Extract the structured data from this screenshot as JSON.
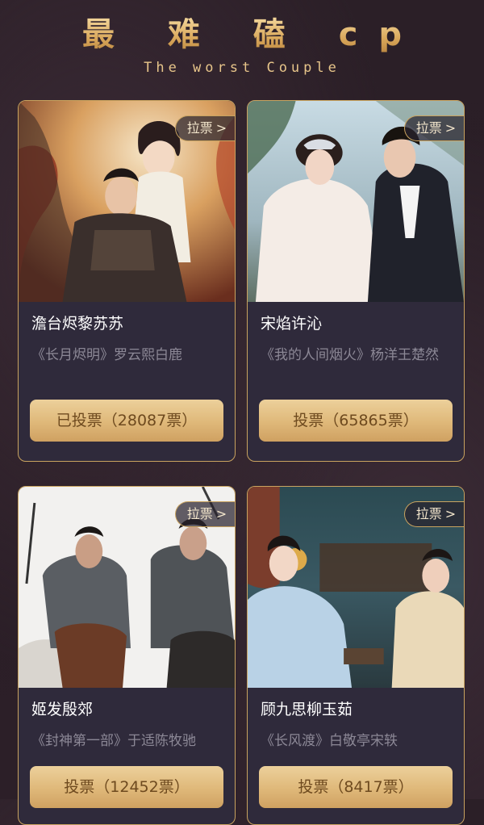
{
  "header": {
    "title": "最 难 磕 cp",
    "subtitle": "The worst Couple"
  },
  "theme": {
    "gold": "#c9a35f",
    "card_bg": "#2f2a3b",
    "page_bg": "#2a1e26",
    "vote_button": "#dfb879"
  },
  "cards": [
    {
      "pull_label": "拉票",
      "pull_icon": "chevron-right-icon",
      "pair_name": "澹台烬黎苏苏",
      "drama": "《长月烬明》罗云熙白鹿",
      "vote_label": "已投票（28087票）",
      "votes": 28087,
      "voted": true
    },
    {
      "pull_label": "拉票",
      "pull_icon": "chevron-right-icon",
      "pair_name": "宋焰许沁",
      "drama": "《我的人间烟火》杨洋王楚然",
      "vote_label": "投票（65865票）",
      "votes": 65865,
      "voted": false
    },
    {
      "pull_label": "拉票",
      "pull_icon": "chevron-right-icon",
      "pair_name": "姬发殷郊",
      "drama": "《封神第一部》于适陈牧驰",
      "vote_label": "投票（12452票）",
      "votes": 12452,
      "voted": false
    },
    {
      "pull_label": "拉票",
      "pull_icon": "chevron-right-icon",
      "pair_name": "顾九思柳玉茹",
      "drama": "《长风渡》白敬亭宋轶",
      "vote_label": "投票（8417票）",
      "votes": 8417,
      "voted": false
    }
  ]
}
